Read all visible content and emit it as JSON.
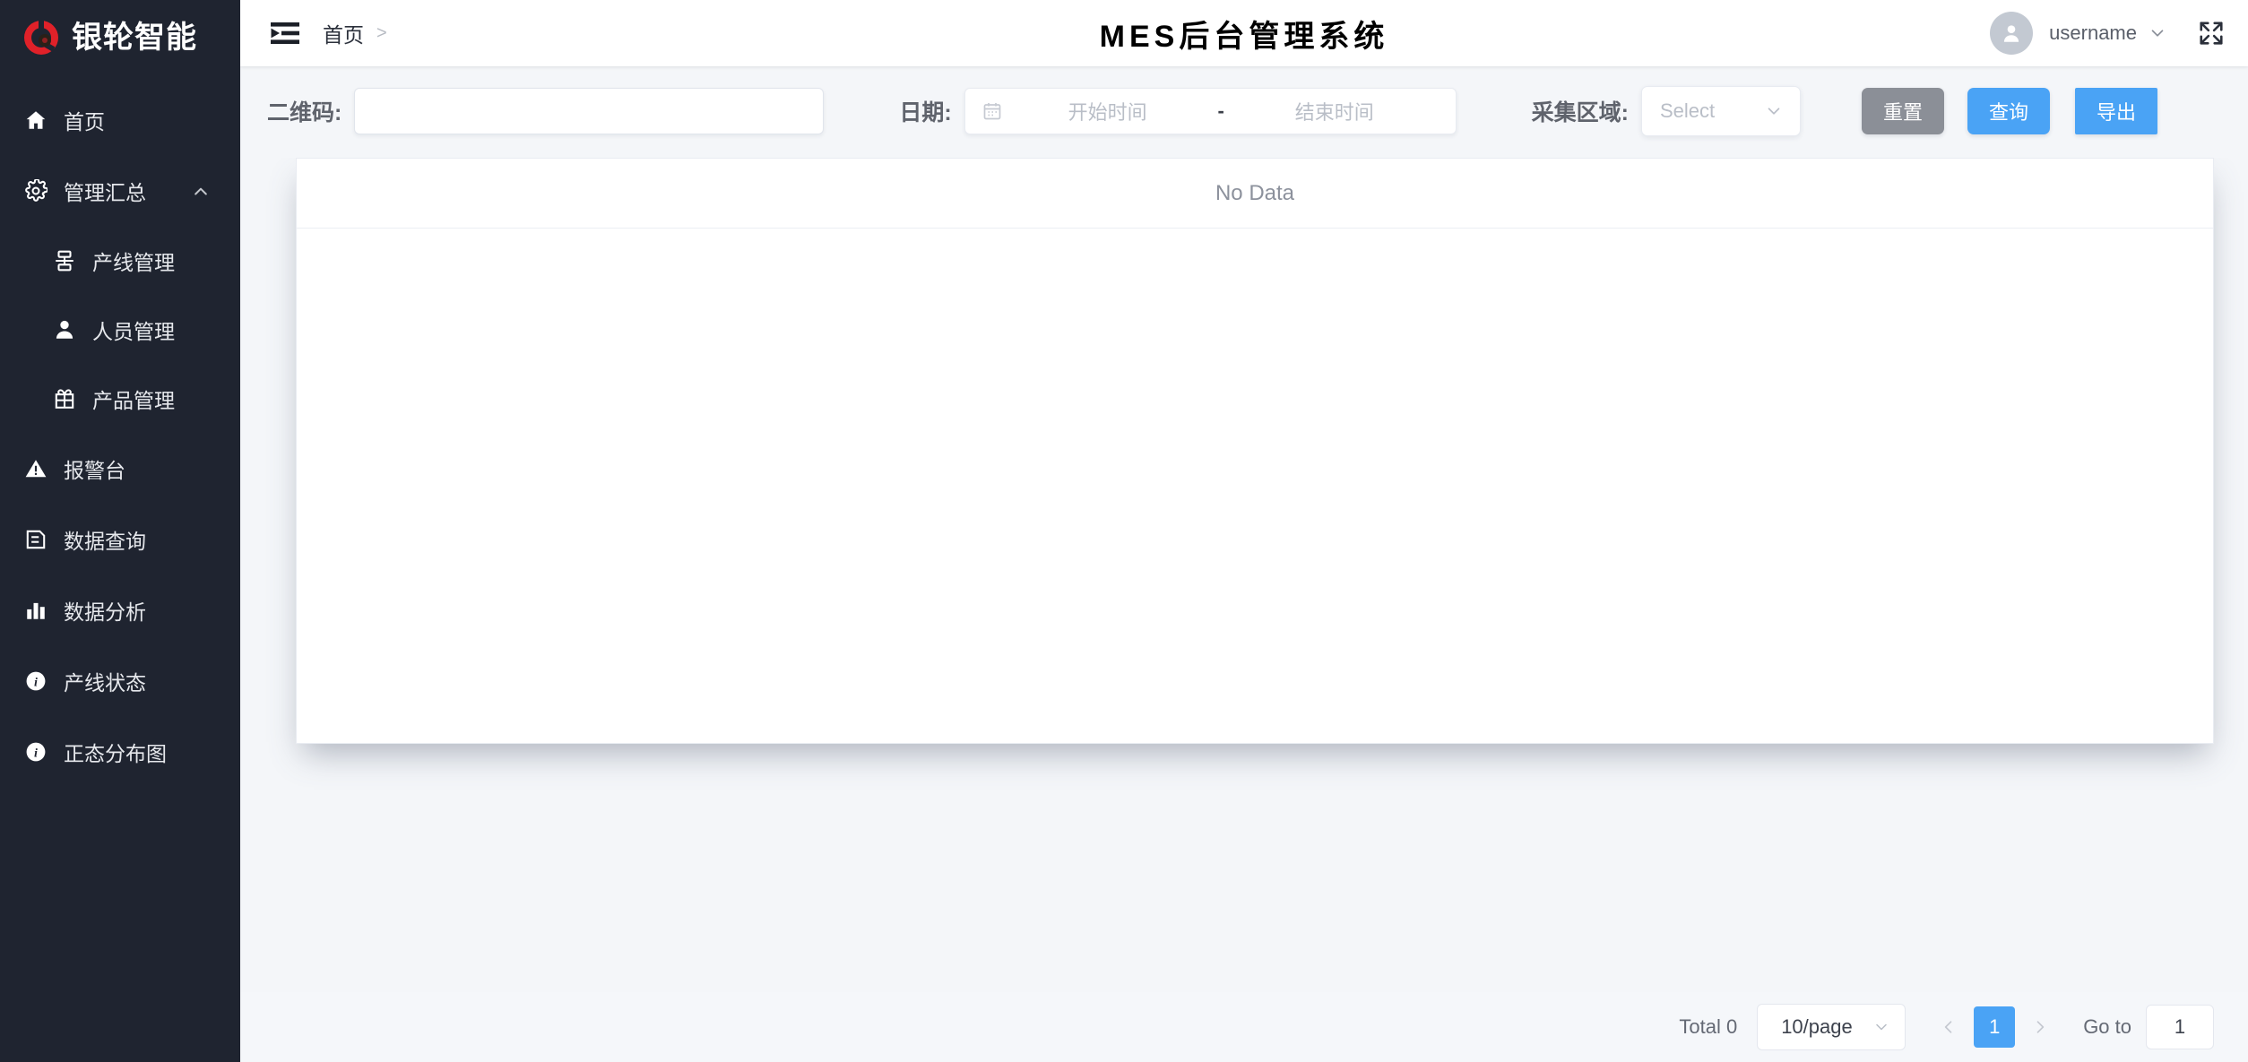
{
  "brand": {
    "name": "银轮智能",
    "logo_icon": "ring-logo-icon",
    "logo_color": "#e02129"
  },
  "sidebar": {
    "items": [
      {
        "label": "首页",
        "icon": "home-icon",
        "level": 1
      },
      {
        "label": "管理汇总",
        "icon": "gear-icon",
        "level": 1,
        "expanded": true,
        "chevron": "chevron-up-icon"
      },
      {
        "label": "产线管理",
        "icon": "production-line-icon",
        "level": 2
      },
      {
        "label": "人员管理",
        "icon": "user-icon",
        "level": 2
      },
      {
        "label": "产品管理",
        "icon": "gift-box-icon",
        "level": 2
      },
      {
        "label": "报警台",
        "icon": "warning-triangle-icon",
        "level": 1
      },
      {
        "label": "数据查询",
        "icon": "document-copy-icon",
        "level": 1
      },
      {
        "label": "数据分析",
        "icon": "bar-chart-icon",
        "level": 1
      },
      {
        "label": "产线状态",
        "icon": "info-circle-icon",
        "level": 1
      },
      {
        "label": "正态分布图",
        "icon": "info-circle-icon",
        "level": 1
      }
    ]
  },
  "topbar": {
    "collapse_icon": "menu-collapse-icon",
    "breadcrumb": {
      "home": "首页",
      "separator": ">"
    },
    "title": "MES后台管理系统",
    "avatar_icon": "user-avatar-icon",
    "username": "username",
    "user_chevron": "chevron-down-icon",
    "fullscreen_icon": "fullscreen-expand-icon"
  },
  "filters": {
    "qrcode": {
      "label": "二维码:",
      "value": "",
      "placeholder": ""
    },
    "date": {
      "label": "日期:",
      "calendar_icon": "calendar-icon",
      "start_placeholder": "开始时间",
      "separator": "-",
      "end_placeholder": "结束时间"
    },
    "area": {
      "label": "采集区域:",
      "selected": "Select",
      "chevron": "chevron-down-icon",
      "options": [
        "Select"
      ]
    },
    "buttons": {
      "reset": "重置",
      "query": "查询",
      "export": "导出"
    }
  },
  "table": {
    "empty_text": "No Data"
  },
  "pagination": {
    "total_text": "Total 0",
    "page_size": "10/page",
    "page_size_chevron": "chevron-down-icon",
    "prev_icon": "chevron-left-icon",
    "next_icon": "chevron-right-icon",
    "current_page": "1",
    "goto_label": "Go to",
    "goto_value": "1"
  },
  "colors": {
    "sidebar_bg": "#1f2430",
    "accent_blue": "#4aa3f5",
    "reset_gray": "#8b8f97",
    "page_bg": "#f4f6f9"
  }
}
